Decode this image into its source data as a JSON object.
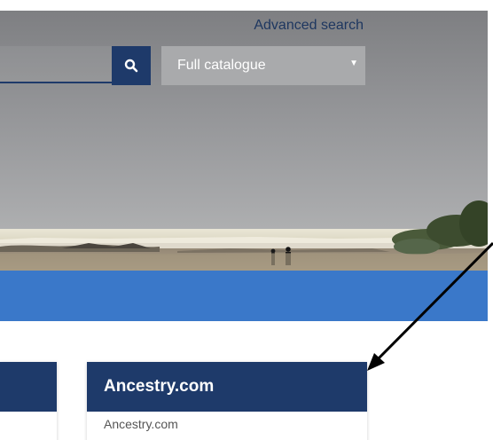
{
  "search": {
    "advanced_search_label": "Advanced search",
    "query_value": "",
    "catalogue_selected": "Full catalogue"
  },
  "icons": {
    "search": "search-icon",
    "dropdown": "chevron-down-icon"
  },
  "cards": {
    "ancestry": {
      "title": "Ancestry.com",
      "link_text": "Ancestry.com"
    }
  },
  "colors": {
    "navy": "#1e3a6a",
    "blue_band": "#3a78c9",
    "sky": "#8b8c8e"
  }
}
